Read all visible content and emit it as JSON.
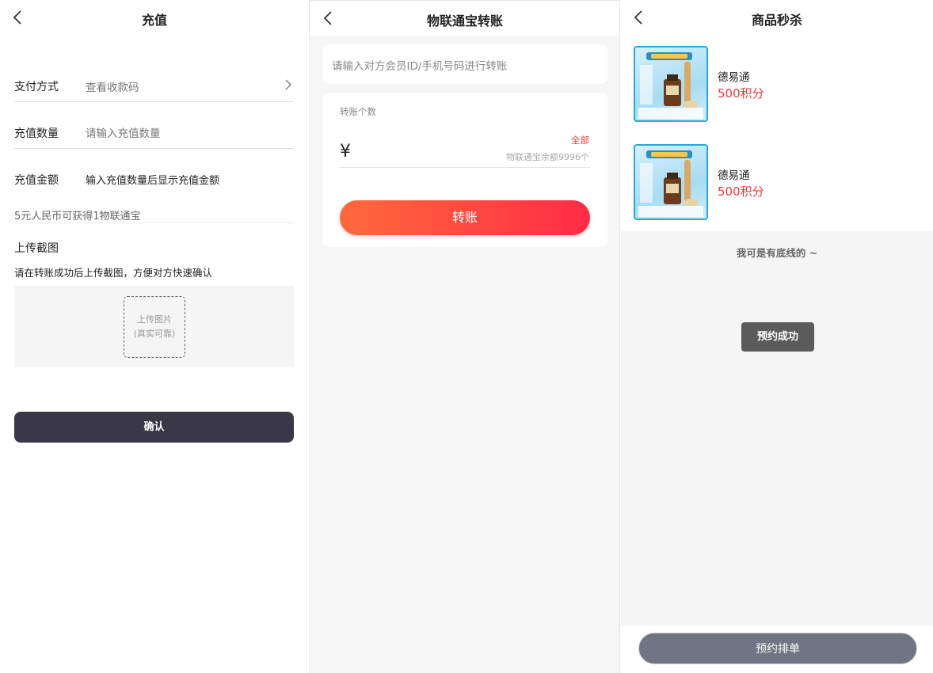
{
  "recharge": {
    "title": "充值",
    "payment_label": "支付方式",
    "payment_value": "查看收款码",
    "qty_label": "充值数量",
    "qty_placeholder": "请输入充值数量",
    "amount_label": "充值金额",
    "amount_value": "输入充值数量后显示充值金额",
    "rate_note": "5元人民币可获得1物联通宝",
    "upload_title": "上传截图",
    "upload_hint": "请在转账成功后上传截图，方便对方快速确认",
    "upload_box_line1": "上传图片",
    "upload_box_line2": "(真实可靠)",
    "confirm_label": "确认"
  },
  "transfer": {
    "title": "物联通宝转账",
    "recipient_placeholder": "请输入对方会员ID/手机号码进行转账",
    "amount_section_label": "转账个数",
    "currency_symbol": "¥",
    "all_label": "全部",
    "balance_text": "物联通宝余额9996个",
    "submit_label": "转账"
  },
  "flash_sale": {
    "title": "商品秒杀",
    "items": [
      {
        "name": "德易通",
        "price": "500积分"
      },
      {
        "name": "德易通",
        "price": "500积分"
      }
    ],
    "bottom_line": "我可是有底线的 ~",
    "toast": "预约成功",
    "reserve_label": "预约排单"
  },
  "colors": {
    "dark_button": "#3a3847",
    "gradient_start": "#ff6a3c",
    "gradient_end": "#ff2c46",
    "price_red": "#f23b3b",
    "pill_grey": "#6f7583"
  },
  "icons": {
    "back": "chevron-left-icon",
    "arrow": "chevron-right-icon"
  }
}
